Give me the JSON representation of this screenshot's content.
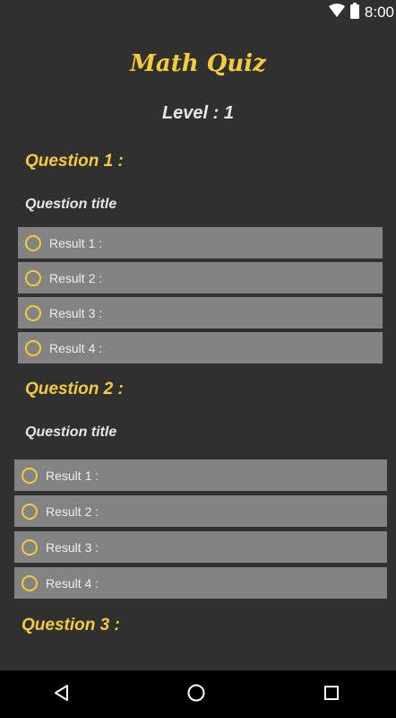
{
  "status_bar": {
    "time": "8:00"
  },
  "app": {
    "title": "Math Quiz",
    "level": "Level : 1"
  },
  "questions": [
    {
      "heading": "Question 1 :",
      "title": "Question title",
      "options": [
        "Result 1 :",
        "Result 2 :",
        "Result 3 :",
        "Result 4 :"
      ]
    },
    {
      "heading": "Question 2 :",
      "title": "Question title",
      "options": [
        "Result 1 :",
        "Result 2 :",
        "Result 3 :",
        "Result 4 :"
      ]
    },
    {
      "heading": "Question 3 :"
    }
  ],
  "colors": {
    "background": "#303030",
    "accent": "#f3cb3b",
    "option_bg": "#838383",
    "nav_bar": "#000000"
  },
  "nav_bar": {
    "icons": [
      "back-icon",
      "home-icon",
      "recents-icon"
    ]
  }
}
